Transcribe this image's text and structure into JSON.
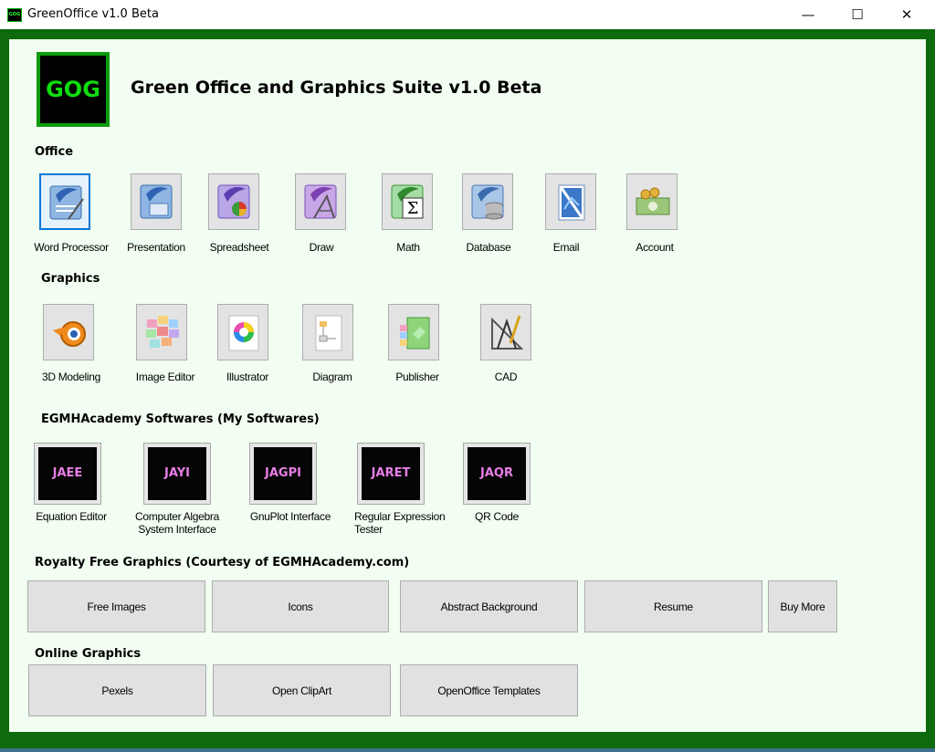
{
  "window": {
    "icon_text": "GOG",
    "title": "GreenOffice v1.0 Beta",
    "controls": {
      "minimize": "—",
      "maximize": "☐",
      "close": "✕"
    }
  },
  "header": {
    "logo_text": "GOG",
    "title": "Green Office and Graphics Suite v1.0 Beta"
  },
  "office": {
    "heading": "Office",
    "items": [
      {
        "label": "Word Processor",
        "icon": "word-processor-icon"
      },
      {
        "label": "Presentation",
        "icon": "presentation-icon"
      },
      {
        "label": "Spreadsheet",
        "icon": "spreadsheet-icon"
      },
      {
        "label": "Draw",
        "icon": "draw-icon"
      },
      {
        "label": "Math",
        "icon": "math-icon"
      },
      {
        "label": "Database",
        "icon": "database-icon"
      },
      {
        "label": "Email",
        "icon": "email-icon"
      },
      {
        "label": "Account",
        "icon": "account-icon"
      }
    ]
  },
  "graphics": {
    "heading": "Graphics",
    "items": [
      {
        "label": "3D Modeling",
        "icon": "blender-icon"
      },
      {
        "label": "Image Editor",
        "icon": "image-editor-icon"
      },
      {
        "label": "Illustrator",
        "icon": "illustrator-icon"
      },
      {
        "label": "Diagram",
        "icon": "diagram-icon"
      },
      {
        "label": "Publisher",
        "icon": "publisher-icon"
      },
      {
        "label": "CAD",
        "icon": "cad-icon"
      }
    ]
  },
  "academy": {
    "heading": "EGMHAcademy Softwares (My Softwares)",
    "items": [
      {
        "tile": "JAEE",
        "label": "Equation Editor"
      },
      {
        "tile": "JAYI",
        "label": "Computer Algebra System Interface"
      },
      {
        "tile": "JAGPI",
        "label": "GnuPlot Interface"
      },
      {
        "tile": "JARET",
        "label": "Regular Expression Tester"
      },
      {
        "tile": "JAQR",
        "label": "QR Code"
      }
    ]
  },
  "royalty": {
    "heading": "Royalty Free Graphics (Courtesy of EGMHAcademy.com)",
    "buttons": [
      "Free Images",
      "Icons",
      "Abstract Background",
      "Resume",
      "Buy More"
    ]
  },
  "online": {
    "heading": "Online Graphics",
    "buttons": [
      "Pexels",
      "Open ClipArt",
      "OpenOffice Templates"
    ]
  },
  "colors": {
    "frame": "#0d6a0d",
    "client_bg": "#f1fef1",
    "logo_text": "#0fdc0f",
    "academy_text": "#e67ee6",
    "selected_border": "#0078d7"
  }
}
